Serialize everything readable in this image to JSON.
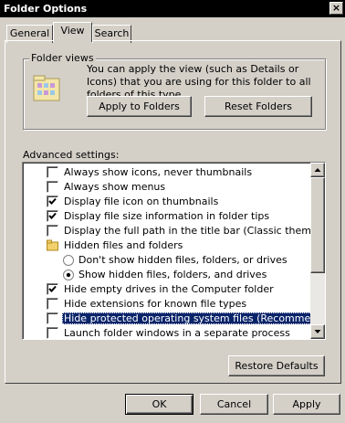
{
  "window": {
    "title": "Folder Options",
    "close_glyph": "×"
  },
  "tabs": [
    {
      "label": "General"
    },
    {
      "label": "View"
    },
    {
      "label": "Search"
    }
  ],
  "folder_views": {
    "label": "Folder views",
    "description": "You can apply the view (such as Details or Icons) that you are using for this folder to all folders of this type.",
    "apply_label": "Apply to Folders",
    "reset_label": "Reset Folders",
    "icon": "folder-views-icon"
  },
  "advanced": {
    "label": "Advanced settings:",
    "items": [
      {
        "type": "checkbox",
        "checked": false,
        "label": "Always show icons, never thumbnails"
      },
      {
        "type": "checkbox",
        "checked": false,
        "label": "Always show menus"
      },
      {
        "type": "checkbox",
        "checked": true,
        "label": "Display file icon on thumbnails"
      },
      {
        "type": "checkbox",
        "checked": true,
        "label": "Display file size information in folder tips"
      },
      {
        "type": "checkbox",
        "checked": false,
        "label": "Display the full path in the title bar (Classic theme only)"
      },
      {
        "type": "folder",
        "label": "Hidden files and folders"
      },
      {
        "type": "radio",
        "checked": false,
        "label": "Don't show hidden files, folders, or drives"
      },
      {
        "type": "radio",
        "checked": true,
        "label": "Show hidden files, folders, and drives"
      },
      {
        "type": "checkbox",
        "checked": true,
        "label": "Hide empty drives in the Computer folder"
      },
      {
        "type": "checkbox",
        "checked": false,
        "label": "Hide extensions for known file types"
      },
      {
        "type": "checkbox",
        "checked": false,
        "label": "Hide protected operating system files (Recommended)",
        "selected": true
      },
      {
        "type": "checkbox",
        "checked": false,
        "label": "Launch folder windows in a separate process"
      }
    ],
    "restore_label": "Restore Defaults"
  },
  "footer": {
    "ok_label": "OK",
    "cancel_label": "Cancel",
    "apply_label": "Apply"
  },
  "colors": {
    "face": "#d4d0c8",
    "selection": "#0a246a",
    "titlebar": "#000000"
  }
}
